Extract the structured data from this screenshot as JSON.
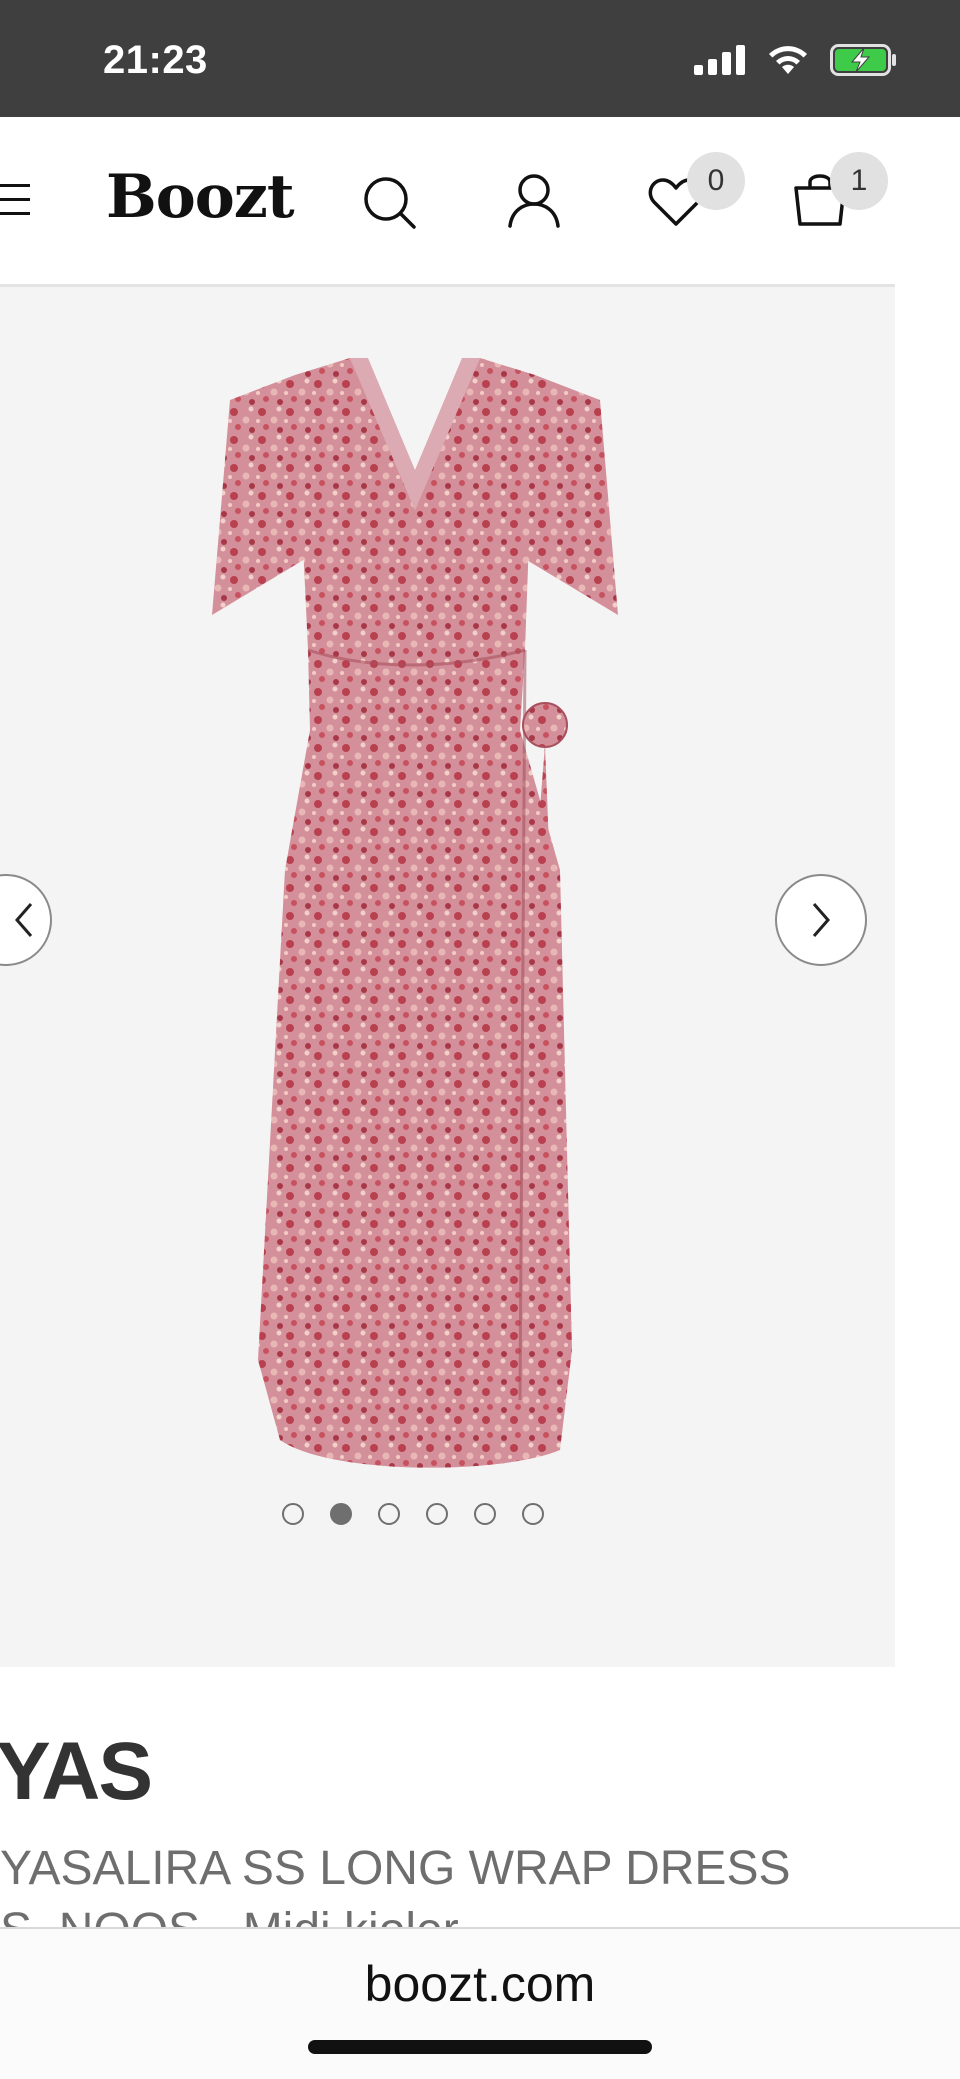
{
  "status_bar": {
    "time": "21:23"
  },
  "header": {
    "logo": "Boozt",
    "wishlist_count": "0",
    "cart_count": "1"
  },
  "gallery": {
    "image_count": 6,
    "active_index": 2
  },
  "product": {
    "brand": "YAS",
    "name_line1": "YASALIRA SS LONG WRAP DRESS",
    "name_line2": "S. NOOS - Midi kjoler"
  },
  "browser": {
    "domain": "boozt.com"
  },
  "colors": {
    "dress": "#c8707e",
    "gallery_bg": "#f5f4f5",
    "status_bar": "#3f3f3f"
  }
}
